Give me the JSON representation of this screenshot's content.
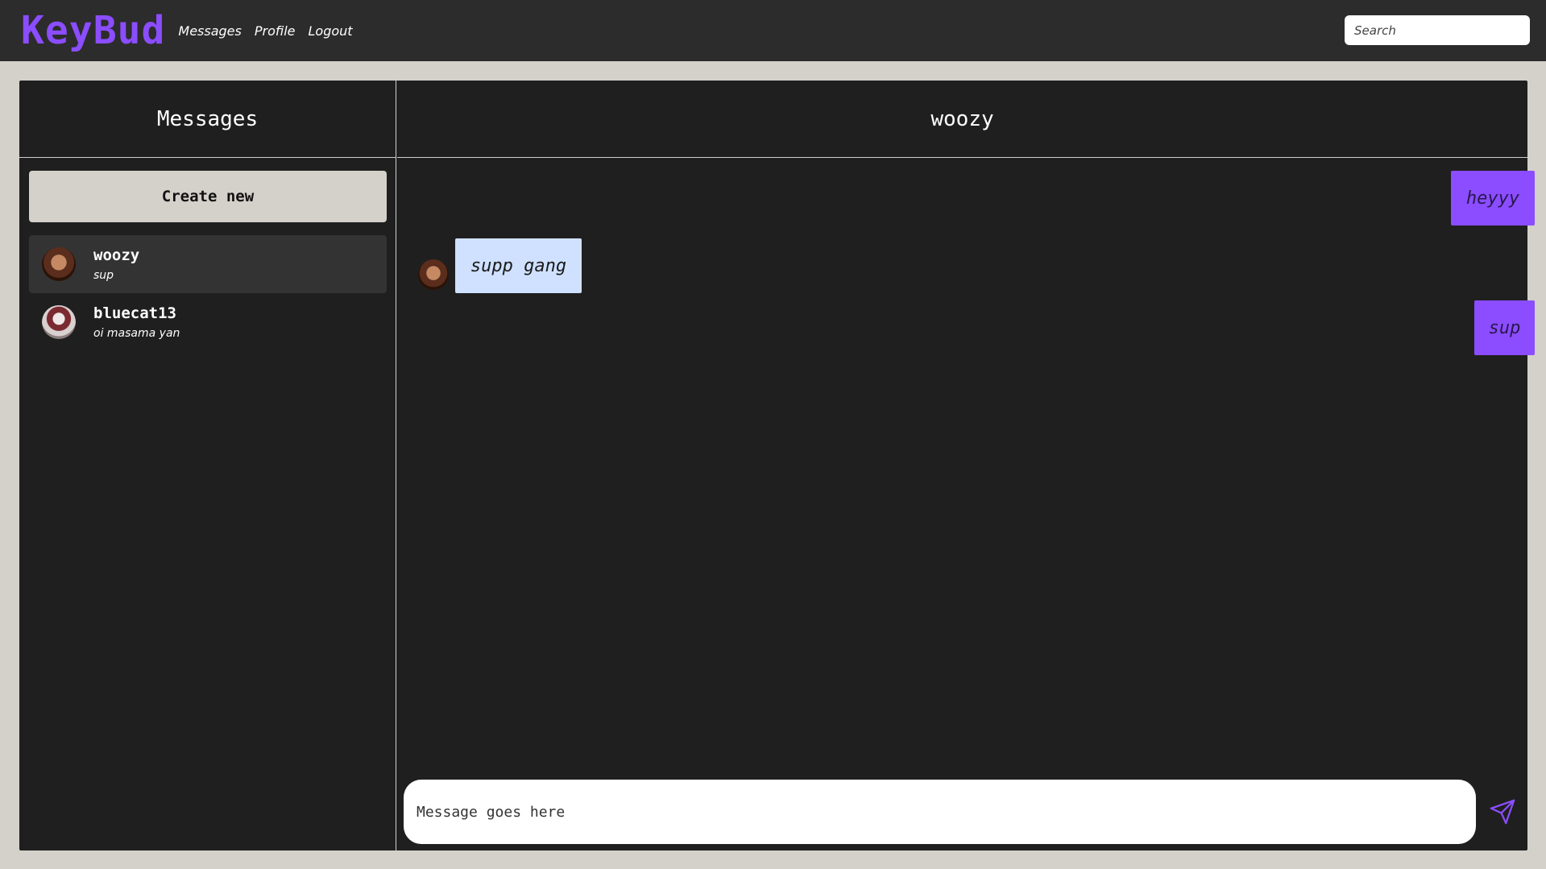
{
  "brand": {
    "name": "KeyBud",
    "accent_color": "#8b4dff"
  },
  "nav": {
    "links": [
      "Messages",
      "Profile",
      "Logout"
    ]
  },
  "search": {
    "placeholder": "Search"
  },
  "sidebar": {
    "title": "Messages",
    "create_label": "Create new",
    "conversations": [
      {
        "name": "woozy",
        "preview": "sup",
        "active": true,
        "avatar": "woozy-avatar"
      },
      {
        "name": "bluecat13",
        "preview": "oi masama yan",
        "active": false,
        "avatar": "bluecat13-avatar"
      }
    ]
  },
  "chat": {
    "title": "woozy",
    "messages": [
      {
        "text": "heyyy",
        "direction": "outgoing"
      },
      {
        "text": "supp gang",
        "direction": "incoming"
      },
      {
        "text": "sup",
        "direction": "outgoing"
      }
    ],
    "composer_placeholder": "Message goes here",
    "send_icon": "send-icon"
  },
  "colors": {
    "outgoing_bubble": "#8b4dff",
    "incoming_bubble": "#cfe1ff",
    "panel_bg": "#1f1f1f",
    "page_bg": "#d4d0ca"
  }
}
